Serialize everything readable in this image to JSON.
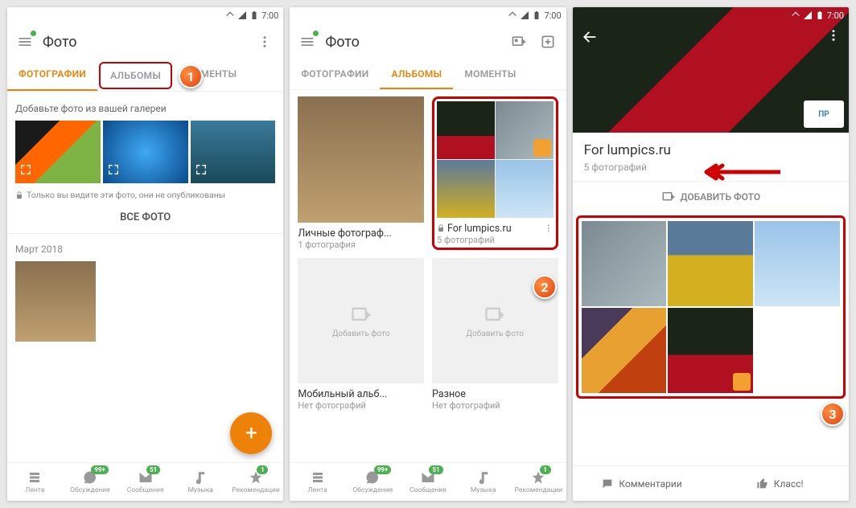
{
  "statusbar": {
    "time": "7:00"
  },
  "screen1": {
    "title": "Фото",
    "tabs": [
      "ФОТОГРАФИИ",
      "АЛЬБОМЫ",
      "МОМЕНТЫ"
    ],
    "hint": "Добавьте фото из вашей галереи",
    "lock_note": "Только вы видите эти фото, они не опубликованы",
    "all_btn": "ВСЕ ФОТО",
    "section": "Март 2018"
  },
  "screen2": {
    "title": "Фото",
    "tabs": [
      "ФОТОГРАФИИ",
      "АЛЬБОМЫ",
      "МОМЕНТЫ"
    ],
    "albums": [
      {
        "title": "Личные фотограф...",
        "count": "1 фотография"
      },
      {
        "title": "For lumpics.ru",
        "count": "5 фотографий",
        "locked": true
      },
      {
        "title": "Мобильный альб...",
        "count": "Нет фотографий",
        "empty": true
      },
      {
        "title": "Разное",
        "count": "Нет фотографий",
        "empty": true
      }
    ],
    "add_photo": "Добавить фото"
  },
  "screen3": {
    "title": "For lumpics.ru",
    "count": "5 фотографий",
    "add_btn": "ДОБАВИТЬ ФОТО",
    "comments": "Комментарии",
    "like": "Класс!"
  },
  "nav": {
    "items": [
      {
        "label": "Лента",
        "badge": ""
      },
      {
        "label": "Обсуждения",
        "badge": "99+"
      },
      {
        "label": "Сообщения",
        "badge": "51"
      },
      {
        "label": "Музыка",
        "badge": ""
      },
      {
        "label": "Рекомендации",
        "badge": "1"
      }
    ]
  },
  "callouts": [
    "1",
    "2",
    "3"
  ]
}
